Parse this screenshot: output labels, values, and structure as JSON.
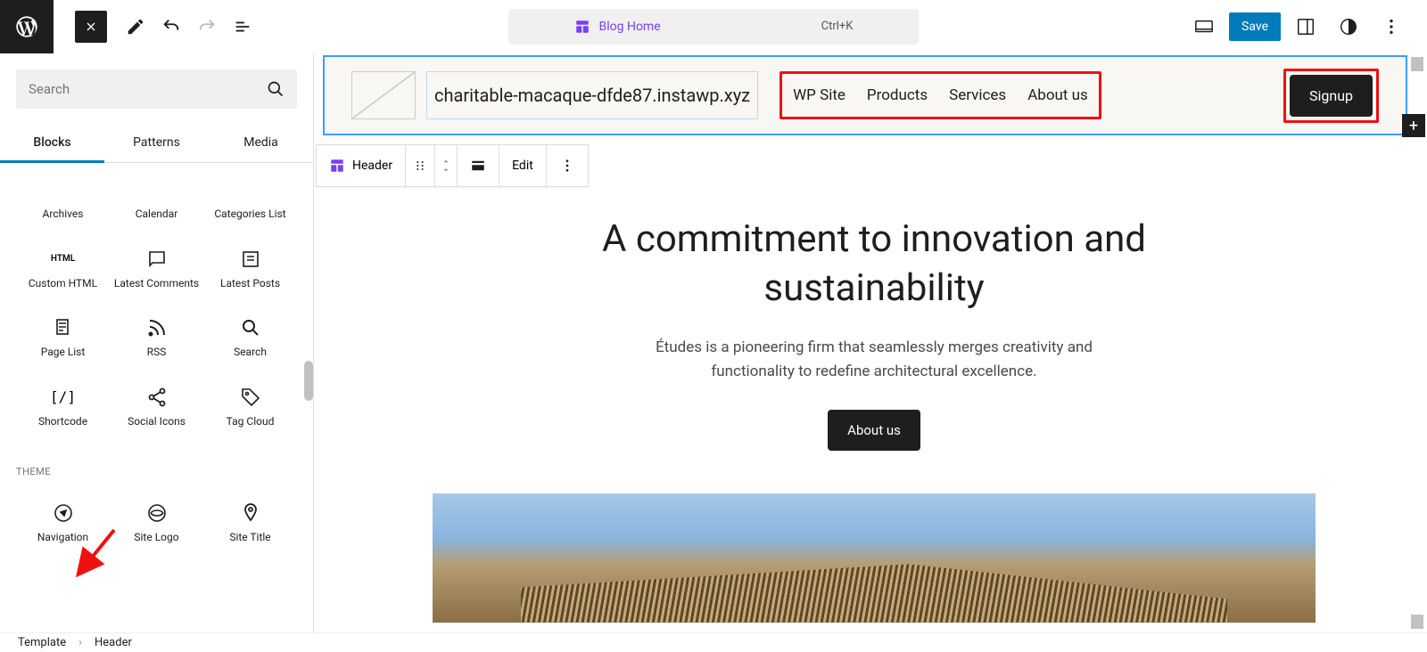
{
  "topbar": {
    "doc_title": "Blog Home",
    "shortcut": "Ctrl+K",
    "save_label": "Save"
  },
  "sidebar": {
    "search_placeholder": "Search",
    "tabs": [
      "Blocks",
      "Patterns",
      "Media"
    ],
    "blocks": [
      {
        "label": "Archives"
      },
      {
        "label": "Calendar"
      },
      {
        "label": "Categories List"
      },
      {
        "label": "Custom HTML"
      },
      {
        "label": "Latest Comments"
      },
      {
        "label": "Latest Posts"
      },
      {
        "label": "Page List"
      },
      {
        "label": "RSS"
      },
      {
        "label": "Search"
      },
      {
        "label": "Shortcode"
      },
      {
        "label": "Social Icons"
      },
      {
        "label": "Tag Cloud"
      }
    ],
    "theme_section_label": "THEME",
    "theme_blocks": [
      {
        "label": "Navigation"
      },
      {
        "label": "Site Logo"
      },
      {
        "label": "Site Title"
      }
    ]
  },
  "floating_toolbar": {
    "block_label": "Header",
    "edit_label": "Edit"
  },
  "site": {
    "title": "charitable-macaque-dfde87.instawp.xyz",
    "nav": [
      "WP Site",
      "Products",
      "Services",
      "About us"
    ],
    "signup_label": "Signup"
  },
  "hero": {
    "heading_line1": "A commitment to innovation and",
    "heading_line2": "sustainability",
    "subtext_line1": "Études is a pioneering firm that seamlessly merges creativity and",
    "subtext_line2": "functionality to redefine architectural excellence.",
    "cta_label": "About us"
  },
  "breadcrumb": {
    "root": "Template",
    "current": "Header"
  }
}
